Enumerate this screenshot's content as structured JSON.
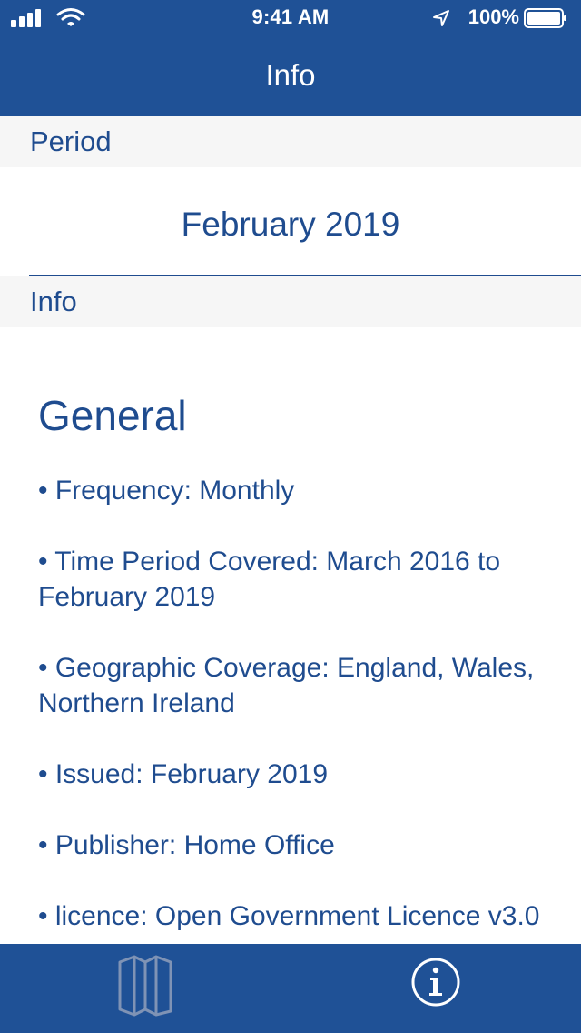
{
  "status_bar": {
    "time": "9:41 AM",
    "battery": "100%"
  },
  "nav": {
    "title": "Info"
  },
  "period_section": {
    "header": "Period",
    "value": "February 2019"
  },
  "info_section": {
    "header": "Info",
    "heading": "General",
    "items": [
      "Frequency: Monthly",
      "Time Period Covered: March 2016 to February 2019",
      "Geographic Coverage: England, Wales, Northern Ireland",
      "Issued: February 2019",
      "Publisher: Home Office",
      "licence: Open Government Licence v3.0"
    ]
  },
  "tab_bar": {
    "tabs": [
      {
        "icon": "map-icon",
        "selected": false
      },
      {
        "icon": "info-icon",
        "selected": true
      }
    ]
  },
  "colors": {
    "brand": "#1f5196",
    "text_accent": "#1f4c8f",
    "section_bg": "#f6f6f6",
    "inactive_tab_icon": "#7f93b5"
  }
}
